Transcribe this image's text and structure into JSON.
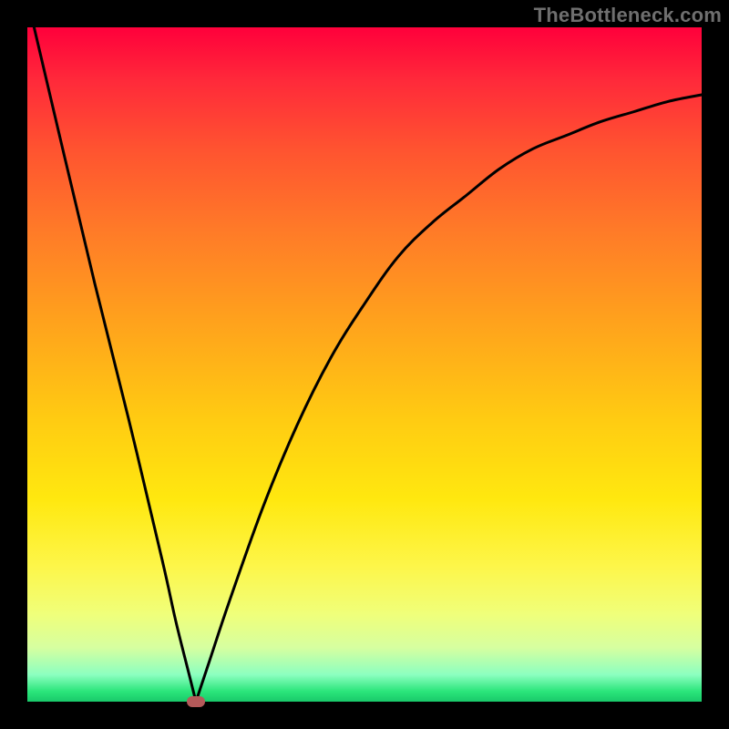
{
  "watermark": "TheBottleneck.com",
  "chart_data": {
    "type": "line",
    "title": "",
    "xlabel": "",
    "ylabel": "",
    "xlim": [
      0,
      100
    ],
    "ylim": [
      0,
      100
    ],
    "grid": false,
    "legend": false,
    "series": [
      {
        "name": "left-branch",
        "x": [
          1,
          5,
          10,
          15,
          20,
          22,
          24,
          25
        ],
        "values": [
          100,
          83,
          62,
          42,
          21,
          12,
          4,
          0
        ]
      },
      {
        "name": "right-branch",
        "x": [
          25,
          27,
          30,
          35,
          40,
          45,
          50,
          55,
          60,
          65,
          70,
          75,
          80,
          85,
          90,
          95,
          100
        ],
        "values": [
          0,
          6,
          15,
          29,
          41,
          51,
          59,
          66,
          71,
          75,
          79,
          82,
          84,
          86,
          87.5,
          89,
          90
        ]
      }
    ],
    "marker": {
      "x": 25,
      "y": 0,
      "color": "#b45a5a"
    },
    "background": "vertical-gradient-red-to-green"
  }
}
